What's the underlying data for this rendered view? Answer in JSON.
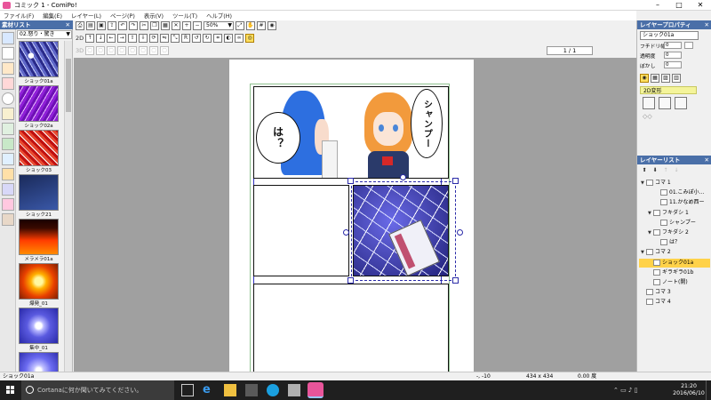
{
  "window": {
    "title": "コミック 1 - ComiPo!",
    "minimize": "–",
    "maximize": "□",
    "close": "✕"
  },
  "menu": [
    "ファイル(F)",
    "編集(E)",
    "レイヤー(L)",
    "ページ(P)",
    "表示(V)",
    "ツール(T)",
    "ヘルプ(H)"
  ],
  "materials": {
    "header": "素材リスト",
    "category": "02.怒り・驚き",
    "items": [
      {
        "label": "ショック01a",
        "style": "lightning-b"
      },
      {
        "label": "ショック02a",
        "style": "lightning-p"
      },
      {
        "label": "ショック03",
        "style": "lightning-r"
      },
      {
        "label": "ショック21",
        "style": "lightning-n"
      },
      {
        "label": "メラメラ01a",
        "style": "fire"
      },
      {
        "label": "爆発_01",
        "style": "explode"
      },
      {
        "label": "集中_01",
        "style": "burst"
      },
      {
        "label": "",
        "style": "burst2"
      }
    ]
  },
  "toolbar": {
    "row_label_2d": "2D",
    "row_label_3d": "3D",
    "zoom": "50%",
    "page_indicator": "1 / 1"
  },
  "canvas": {
    "bubble1": "シャンプー",
    "bubble2": "は？"
  },
  "properties": {
    "header": "レイヤープロパティ",
    "layer_name": "ショック01a",
    "rows": [
      {
        "label": "フチドリ幅",
        "value": "0"
      },
      {
        "label": "透明度",
        "value": "0"
      },
      {
        "label": "ぼかし",
        "value": "0"
      }
    ],
    "tab": "2D変形"
  },
  "layers": {
    "header": "レイヤーリスト",
    "items": [
      {
        "label": "コマ 1",
        "indent": 0,
        "exp": "▼",
        "active": false
      },
      {
        "label": "01.こみぽ小…",
        "indent": 2,
        "exp": "",
        "active": false
      },
      {
        "label": "11.かなめ西ー",
        "indent": 2,
        "exp": "",
        "active": false
      },
      {
        "label": "フキダシ 1",
        "indent": 1,
        "exp": "▼",
        "active": false
      },
      {
        "label": "シャンプー",
        "indent": 2,
        "exp": "",
        "active": false
      },
      {
        "label": "フキダシ 2",
        "indent": 1,
        "exp": "▼",
        "active": false
      },
      {
        "label": "は？",
        "indent": 2,
        "exp": "",
        "active": false
      },
      {
        "label": "コマ 2",
        "indent": 0,
        "exp": "▼",
        "active": false
      },
      {
        "label": "ショック01a",
        "indent": 1,
        "exp": "",
        "active": true
      },
      {
        "label": "ギラギラ01b",
        "indent": 1,
        "exp": "",
        "active": false
      },
      {
        "label": "ノート(開)",
        "indent": 1,
        "exp": "",
        "active": false
      },
      {
        "label": "コマ 3",
        "indent": 0,
        "exp": "",
        "active": false
      },
      {
        "label": "コマ 4",
        "indent": 0,
        "exp": "",
        "active": false
      }
    ]
  },
  "status": {
    "layer": "ショック01a",
    "coords": "-, -10",
    "size": "434 x 434",
    "angle": "0.00 度"
  },
  "taskbar": {
    "cortana": "Cortanaに何か聞いてみてください。",
    "time": "21:20",
    "date": "2016/06/10"
  }
}
